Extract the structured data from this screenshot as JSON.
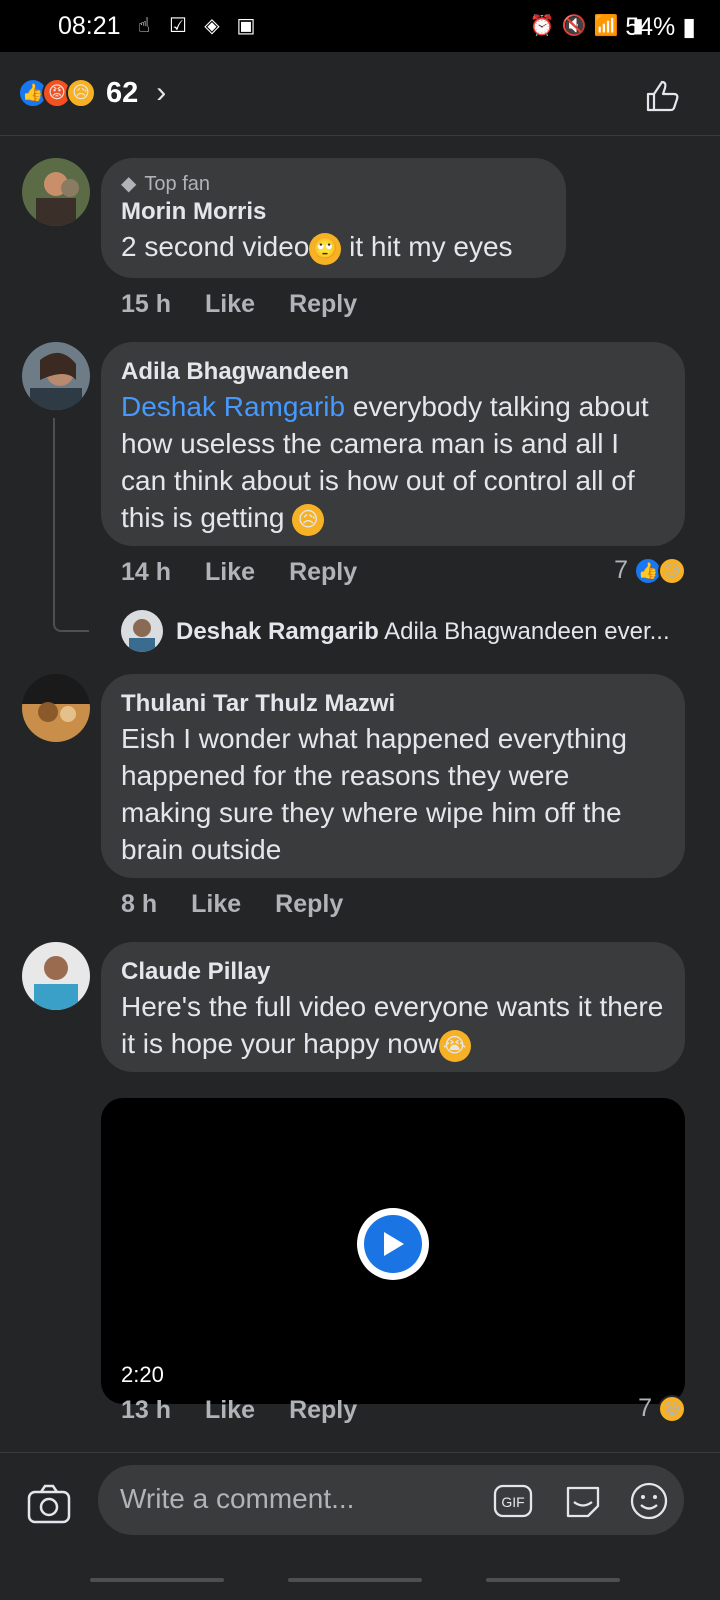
{
  "status": {
    "time": "08:21",
    "battery": "54%"
  },
  "reactions": {
    "count": "62"
  },
  "comments": [
    {
      "badge": "Top fan",
      "author": "Morin Morris",
      "text_before": "2 second video",
      "text_after": " it hit my eyes",
      "time": "15 h",
      "like": "Like",
      "reply": "Reply"
    },
    {
      "author": "Adila Bhagwandeen",
      "mention": "Deshak Ramgarib",
      "text": " everybody talking about how useless the camera man is and all I can think about is how out of control all of this is getting ",
      "time": "14 h",
      "like": "Like",
      "reply": "Reply",
      "reaction_count": "7"
    },
    {
      "author": "Thulani Tar Thulz Mazwi",
      "text": "Eish I wonder what happened everything happened for the reasons they were making sure they where wipe him off the brain outside",
      "time": "8 h",
      "like": "Like",
      "reply": "Reply"
    },
    {
      "author": "Claude Pillay",
      "text": "Here's the full video everyone wants it there it is hope your happy now",
      "video_duration": "2:20",
      "time": "13 h",
      "like": "Like",
      "reply": "Reply",
      "reaction_count": "7"
    }
  ],
  "reply_preview": {
    "author": "Deshak Ramgarib",
    "text": "Adila Bhagwandeen ever..."
  },
  "composer": {
    "placeholder": "Write a comment..."
  }
}
